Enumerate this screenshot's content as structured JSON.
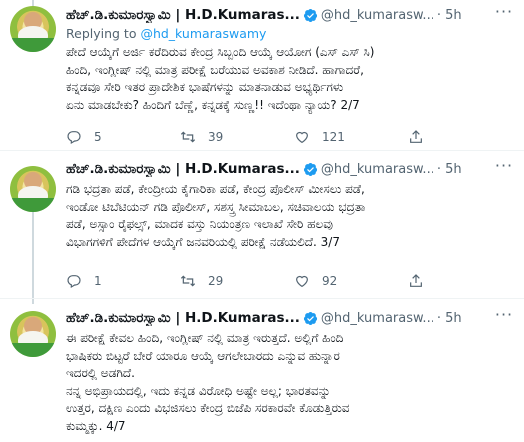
{
  "colors": {
    "accent": "#1d9bf0",
    "text": "#0f1419",
    "secondary": "#536471"
  },
  "tweets": [
    {
      "name": "ಹೆಚ್.ಡಿ.ಕುಮಾರಸ್ವಾಮಿ | H.D.Kumaras...",
      "handle": "@hd_kumarasw...",
      "dot": "·",
      "time": "5h",
      "reply_prefix": "Replying to ",
      "reply_mention": "@hd_kumaraswamy",
      "text": "ಪೇದೆ ಆಯ್ಕೆಗೆ ಅರ್ಜಿ ಕರೆದಿರುವ ಕೇಂದ್ರ ಸಿಬ್ಬಂದಿ ಆಯ್ಕೆ ಆಯೋಗ (ಎಸ್ ಎಸ್ ಸಿ)\nಹಿಂದಿ, ಇಂಗ್ಲೀಷ್ ನಲ್ಲಿ ಮಾತ್ರ ಪರೀಕ್ಷೆ ಬರೆಯುವ ಅವಕಾಶ ನೀಡಿದೆ. ಹಾಗಾದರೆ,\nಕನ್ನಡವೂ ಸೇರಿ ಇತರ ಪ್ರಾದೇಶಿಕ ಭಾಷೆಗಳನ್ನು ಮಾತನಾಡುವ ಅಭ್ಯರ್ಥಿಗಳು\nಏನು ಮಾಡಬೇಕು? ಹಿಂದಿಗೆ ಬೆಣ್ಣೆ, ಕನ್ನಡಕ್ಕೆ ಸುಣ್ಣ!! ಇದೆಂಥಾ ನ್ಯಾಯ? 2/7",
      "replies": "5",
      "retweets": "39",
      "likes": "121"
    },
    {
      "name": "ಹೆಚ್.ಡಿ.ಕುಮಾರಸ್ವಾಮಿ | H.D.Kumaras...",
      "handle": "@hd_kumarasw...",
      "dot": "·",
      "time": "5h",
      "text": "ಗಡಿ ಭದ್ರತಾ ಪಡೆ, ಕೇಂದ್ರೀಯ ಕೈಗಾರಿಕಾ ಪಡೆ, ಕೇಂದ್ರ ಪೊಲೀಸ್ ಮೀಸಲು ಪಡೆ,\nಇಂಡೋ ಟಿಬೆಟಿಯನ್ ಗಡಿ ಪೊಲೀಸ್, ಸಶಸ್ತ್ರ ಸೀಮಾಬಲ, ಸಚಿವಾಲಯ ಭದ್ರತಾ\nಪಡೆ, ಅಸ್ಸಾಂ ರೈಫಲ್ಸ್, ಮಾದಕ ವಸ್ತು ನಿಯಂತ್ರಣ ಇಲಾಖೆ ಸೇರಿ ಹಲವು\nವಿಭಾಗಗಳಿಗೆ ಪೇದೆಗಳ ಆಯ್ಕೆಗೆ ಜನವರಿಯಲ್ಲಿ ಪರೀಕ್ಷೆ ನಡೆಯಲಿದೆ. 3/7",
      "replies": "1",
      "retweets": "29",
      "likes": "92"
    },
    {
      "name": "ಹೆಚ್.ಡಿ.ಕುಮಾರಸ್ವಾಮಿ | H.D.Kumaras...",
      "handle": "@hd_kumarasw...",
      "dot": "·",
      "time": "5h",
      "text": "ಈ ಪರೀಕ್ಷೆ ಕೇವಲ ಹಿಂದಿ, ಇಂಗ್ಲೀಷ್ ನಲ್ಲಿ ಮಾತ್ರ ಇರುತ್ತದೆ. ಅಲ್ಲಿಗೆ ಹಿಂದಿ\nಭಾಷಿಕರು ಬಿಟ್ಟರೆ ಬೇರೆ ಯಾರೂ ಆಯ್ಕೆ ಆಗಲೇಬಾರದು ಎನ್ನುವ ಹುನ್ನಾರ\nಇದರಲ್ಲಿ ಅಡಗಿದೆ.\nನನ್ನ ಅಭಿಪ್ರಾಯದಲ್ಲಿ, ಇದು ಕನ್ನಡ ವಿರೋಧಿ ಅಷ್ಟೇ ಅಲ್ಲ; ಭಾರತವನ್ನು\nಉತ್ತರ, ದಕ್ಷಿಣ ಎಂದು ವಿಭಜಿಸಲು ಕೇಂದ್ರ ಬಿಜೆಪಿ ಸರಕಾರವೇ ಕೊಡುತ್ತಿರುವ\nಕುಮ್ಮಕ್ಕು. 4/7"
    }
  ]
}
